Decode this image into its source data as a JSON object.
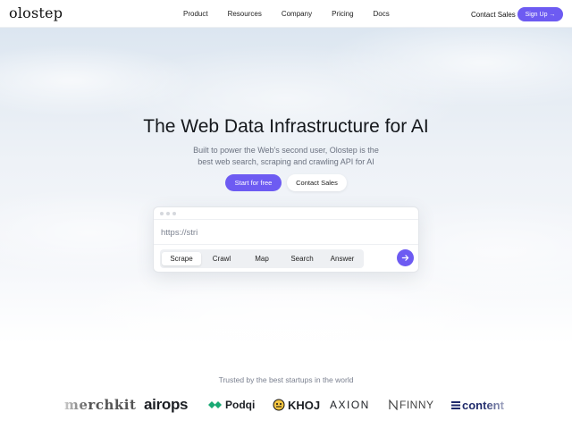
{
  "nav": {
    "logo": "olostep",
    "menu": [
      "Product",
      "Resources",
      "Company",
      "Pricing",
      "Docs"
    ],
    "contact_sales": "Contact Sales",
    "signup": "Sign Up →"
  },
  "hero": {
    "title": "The Web Data Infrastructure for AI",
    "subtitle": "Built to power the Web's second user, Olostep is the best web search, scraping and crawling API for AI",
    "start_button": "Start for free",
    "contact_button": "Contact Sales"
  },
  "widget": {
    "url_placeholder": "https://stri",
    "tabs": [
      "Scrape",
      "Crawl",
      "Map",
      "Search",
      "Answer"
    ],
    "active_tab": "Scrape",
    "accent": "#6d5bf2"
  },
  "trusted": {
    "heading": "Trusted by the best startups in the world",
    "logos": [
      "merchkit",
      "airops",
      "Podqi",
      "KHOJ",
      "AXION",
      "FINNY",
      "content"
    ]
  }
}
